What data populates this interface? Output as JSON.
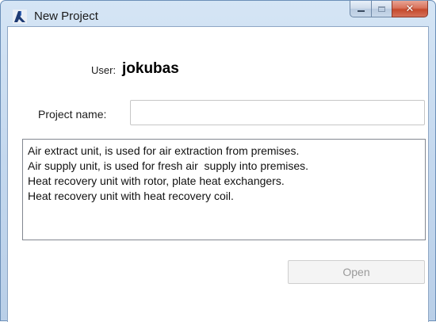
{
  "window": {
    "title": "New Project",
    "icon": "app-logo-icon",
    "caption_buttons": {
      "minimize": "minimize-icon",
      "maximize": "maximize-icon",
      "close": "close-icon"
    }
  },
  "user": {
    "label": "User:",
    "value": "jokubas"
  },
  "project": {
    "label": "Project name:",
    "value": "",
    "placeholder": ""
  },
  "description": {
    "lines": [
      "Air extract unit, is used for air extraction from premises.",
      "Air supply unit, is used for fresh air  supply into premises.",
      "Heat recovery unit with rotor, plate heat exchangers.",
      "Heat recovery unit with heat recovery coil."
    ]
  },
  "actions": {
    "open_label": "Open",
    "open_enabled": false
  },
  "colors": {
    "frame": "#c4d8ee",
    "close_button": "#c54a2c",
    "disabled_text": "#9a9a9a"
  }
}
